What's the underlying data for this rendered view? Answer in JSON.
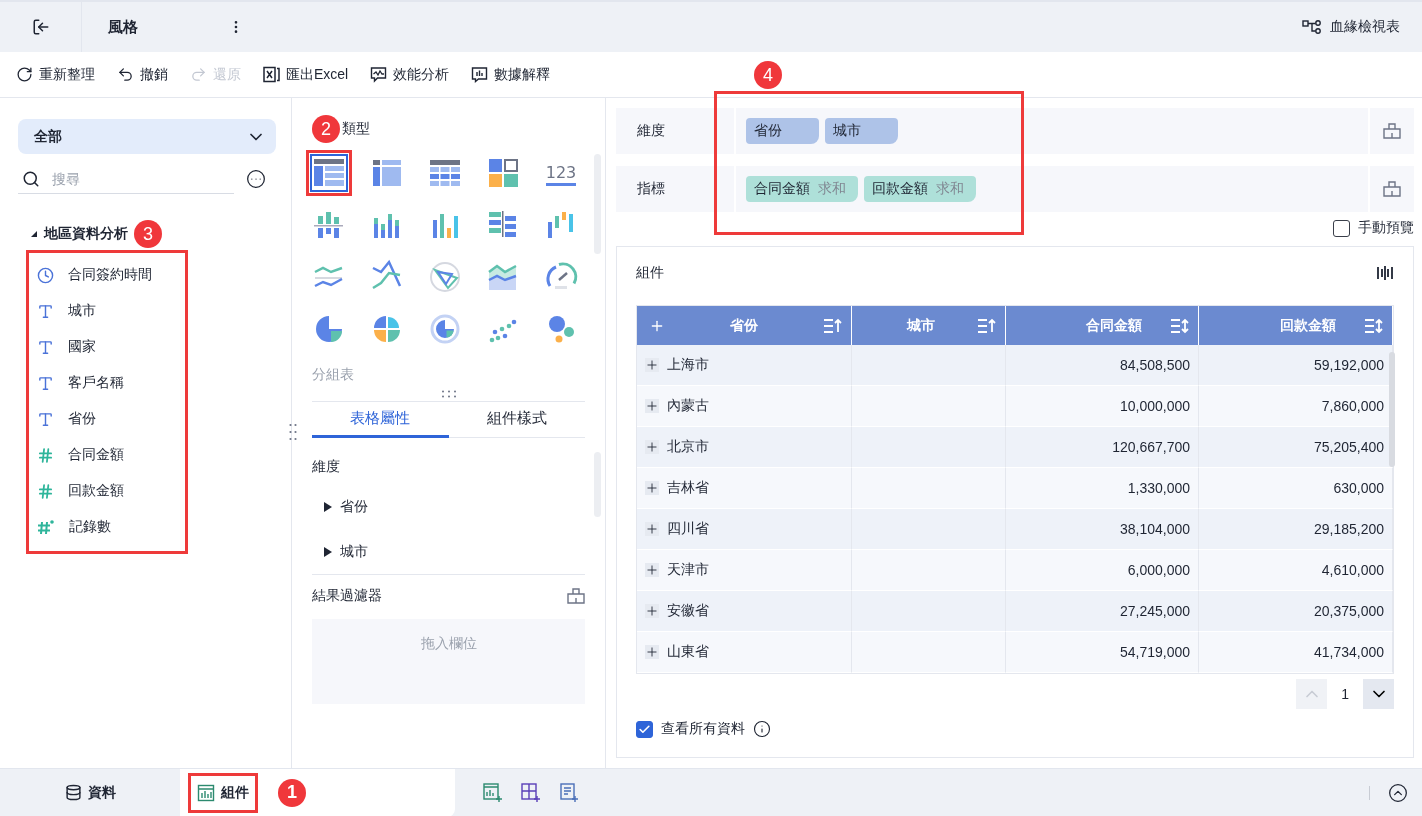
{
  "header": {
    "title": "風格",
    "lineage": "血緣檢視表"
  },
  "toolbar": [
    {
      "label": "重新整理",
      "kind": "refresh",
      "disabled": false
    },
    {
      "label": "撤銷",
      "kind": "undo",
      "disabled": false
    },
    {
      "label": "還原",
      "kind": "redo",
      "disabled": true
    },
    {
      "label": "匯出Excel",
      "kind": "excel",
      "disabled": false
    },
    {
      "label": "效能分析",
      "kind": "performance",
      "disabled": false
    },
    {
      "label": "數據解釋",
      "kind": "explain",
      "disabled": false
    }
  ],
  "data_panel": {
    "scope": "全部",
    "search_placeholder": "搜尋",
    "dataset": {
      "name": "地區資料分析",
      "expanded": true,
      "callout": "3",
      "fields": [
        {
          "name": "合同簽約時間",
          "kind": "time"
        },
        {
          "name": "城市",
          "kind": "text"
        },
        {
          "name": "國家",
          "kind": "text"
        },
        {
          "name": "客戶名稱",
          "kind": "text"
        },
        {
          "name": "省份",
          "kind": "text"
        },
        {
          "name": "合同金額",
          "kind": "number"
        },
        {
          "name": "回款金額",
          "kind": "number"
        },
        {
          "name": "記錄數",
          "kind": "count"
        }
      ]
    }
  },
  "chart_types": {
    "title": "類型",
    "callout": "2",
    "hint": "分組表",
    "items": [
      {
        "kind": "group-table",
        "selected": true
      },
      {
        "kind": "crosstab",
        "selected": false
      },
      {
        "kind": "detail-table",
        "selected": false
      },
      {
        "kind": "card",
        "selected": false
      },
      {
        "kind": "kpi",
        "text": "123",
        "selected": false
      },
      {
        "kind": "bar-diverging",
        "selected": false
      },
      {
        "kind": "bar-stacked",
        "selected": false
      },
      {
        "kind": "bar",
        "selected": false
      },
      {
        "kind": "bar-horizontal",
        "selected": false
      },
      {
        "kind": "waterfall",
        "selected": false
      },
      {
        "kind": "line",
        "selected": false
      },
      {
        "kind": "line-cross",
        "selected": false
      },
      {
        "kind": "radar",
        "selected": false
      },
      {
        "kind": "area",
        "selected": false
      },
      {
        "kind": "gauge",
        "selected": false
      },
      {
        "kind": "pie",
        "selected": false
      },
      {
        "kind": "rose",
        "selected": false
      },
      {
        "kind": "ring",
        "selected": false
      },
      {
        "kind": "scatter",
        "selected": false
      },
      {
        "kind": "bubble",
        "selected": false
      }
    ]
  },
  "properties": {
    "tabs": [
      {
        "label": "表格屬性",
        "selected": true
      },
      {
        "label": "組件樣式",
        "selected": false
      }
    ],
    "section": {
      "title": "維度",
      "items": [
        {
          "name": "省份",
          "expanded": false
        },
        {
          "name": "城市",
          "expanded": false
        }
      ]
    },
    "filter": {
      "title": "結果過濾器",
      "placeholder": "拖入欄位"
    }
  },
  "shelves": {
    "callout": "4",
    "rows": [
      {
        "label": "維度",
        "kind": "dimension",
        "chips": [
          {
            "name": "省份"
          },
          {
            "name": "城市"
          }
        ]
      },
      {
        "label": "指標",
        "kind": "measure",
        "chips": [
          {
            "name": "合同金額",
            "aggregation": "求和"
          },
          {
            "name": "回款金額",
            "aggregation": "求和"
          }
        ]
      }
    ]
  },
  "manual_preview": {
    "label": "手動預覽",
    "checked": false
  },
  "widget": {
    "title": "組件",
    "columns": [
      {
        "label": "省份",
        "kind": "dimension"
      },
      {
        "label": "城市",
        "kind": "dimension"
      },
      {
        "label": "合同金額",
        "kind": "measure"
      },
      {
        "label": "回款金額",
        "kind": "measure"
      }
    ],
    "rows": [
      {
        "label": "上海市",
        "values": [
          "84,508,500",
          "59,192,000"
        ]
      },
      {
        "label": "內蒙古",
        "values": [
          "10,000,000",
          "7,860,000"
        ]
      },
      {
        "label": "北京市",
        "values": [
          "120,667,700",
          "75,205,400"
        ]
      },
      {
        "label": "吉林省",
        "values": [
          "1,330,000",
          "630,000"
        ]
      },
      {
        "label": "四川省",
        "values": [
          "38,104,000",
          "29,185,200"
        ]
      },
      {
        "label": "天津市",
        "values": [
          "6,000,000",
          "4,610,000"
        ]
      },
      {
        "label": "安徽省",
        "values": [
          "27,245,000",
          "20,375,000"
        ]
      },
      {
        "label": "山東省",
        "values": [
          "54,719,000",
          "41,734,000"
        ]
      }
    ],
    "page": "1",
    "prev_disabled": true,
    "show_all": {
      "label": "查看所有資料",
      "checked": true
    }
  },
  "bottom_tabs": [
    {
      "label": "資料",
      "kind": "data",
      "selected": false
    },
    {
      "label": "組件",
      "kind": "widget",
      "selected": true,
      "callout": "1"
    }
  ]
}
